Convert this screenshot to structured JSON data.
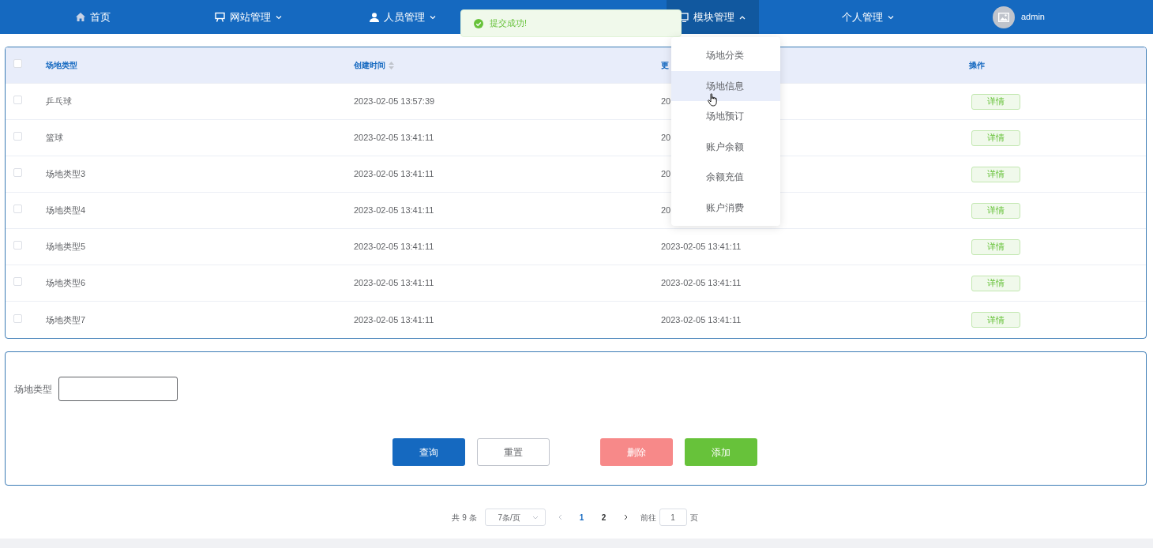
{
  "nav": {
    "items": [
      {
        "label": "首页",
        "kind": "link"
      },
      {
        "label": "网站管理",
        "kind": "menu",
        "expanded": false
      },
      {
        "label": "人员管理",
        "kind": "menu",
        "expanded": false
      },
      {
        "kind": "hidden"
      },
      {
        "label": "模块管理",
        "kind": "menu",
        "expanded": true
      },
      {
        "label": "个人管理",
        "kind": "menu",
        "expanded": false
      }
    ],
    "user": {
      "name": "admin"
    }
  },
  "toast": {
    "text": "提交成功!"
  },
  "menu": {
    "items": [
      {
        "label": "场地分类",
        "selected": false
      },
      {
        "label": "场地信息",
        "selected": true
      },
      {
        "label": "场地预订",
        "selected": false
      },
      {
        "label": "账户余额",
        "selected": false
      },
      {
        "label": "余额充值",
        "selected": false
      },
      {
        "label": "账户消费",
        "selected": false
      }
    ]
  },
  "table": {
    "select_all": {
      "checked": false
    },
    "columns": [
      {
        "label": "场地类型",
        "sortable": false
      },
      {
        "label": "创建时间",
        "sortable": true
      },
      {
        "label": "更",
        "sortable": false
      },
      {
        "label": "操作",
        "sortable": false
      }
    ],
    "rows": [
      {
        "checked": false,
        "cells": [
          "乒乓球",
          "2023-02-05 13:57:39",
          "20"
        ],
        "action": "详情"
      },
      {
        "checked": false,
        "cells": [
          "篮球",
          "2023-02-05 13:41:11",
          "20"
        ],
        "action": "详情"
      },
      {
        "checked": false,
        "cells": [
          "场地类型3",
          "2023-02-05 13:41:11",
          "20"
        ],
        "action": "详情"
      },
      {
        "checked": false,
        "cells": [
          "场地类型4",
          "2023-02-05 13:41:11",
          "20"
        ],
        "action": "详情"
      },
      {
        "checked": false,
        "cells": [
          "场地类型5",
          "2023-02-05 13:41:11",
          "2023-02-05 13:41:11"
        ],
        "action": "详情"
      },
      {
        "checked": false,
        "cells": [
          "场地类型6",
          "2023-02-05 13:41:11",
          "2023-02-05 13:41:11"
        ],
        "action": "详情"
      },
      {
        "checked": false,
        "cells": [
          "场地类型7",
          "2023-02-05 13:41:11",
          "2023-02-05 13:41:11"
        ],
        "action": "详情"
      }
    ]
  },
  "search": {
    "label": "场地类型",
    "buttons": [
      {
        "label": "查询",
        "kind": "primary"
      },
      {
        "label": "重置",
        "kind": "default"
      },
      {
        "label": "删除",
        "kind": "danger"
      },
      {
        "label": "添加",
        "kind": "success"
      }
    ]
  },
  "pagination": {
    "total": "共 9 条",
    "page_size": "7条/页",
    "pages": [
      {
        "label": "1",
        "selected": true
      },
      {
        "label": "2",
        "selected": false
      }
    ],
    "goto_label": "前往",
    "goto_value": "1",
    "goto_suffix": "页"
  }
}
